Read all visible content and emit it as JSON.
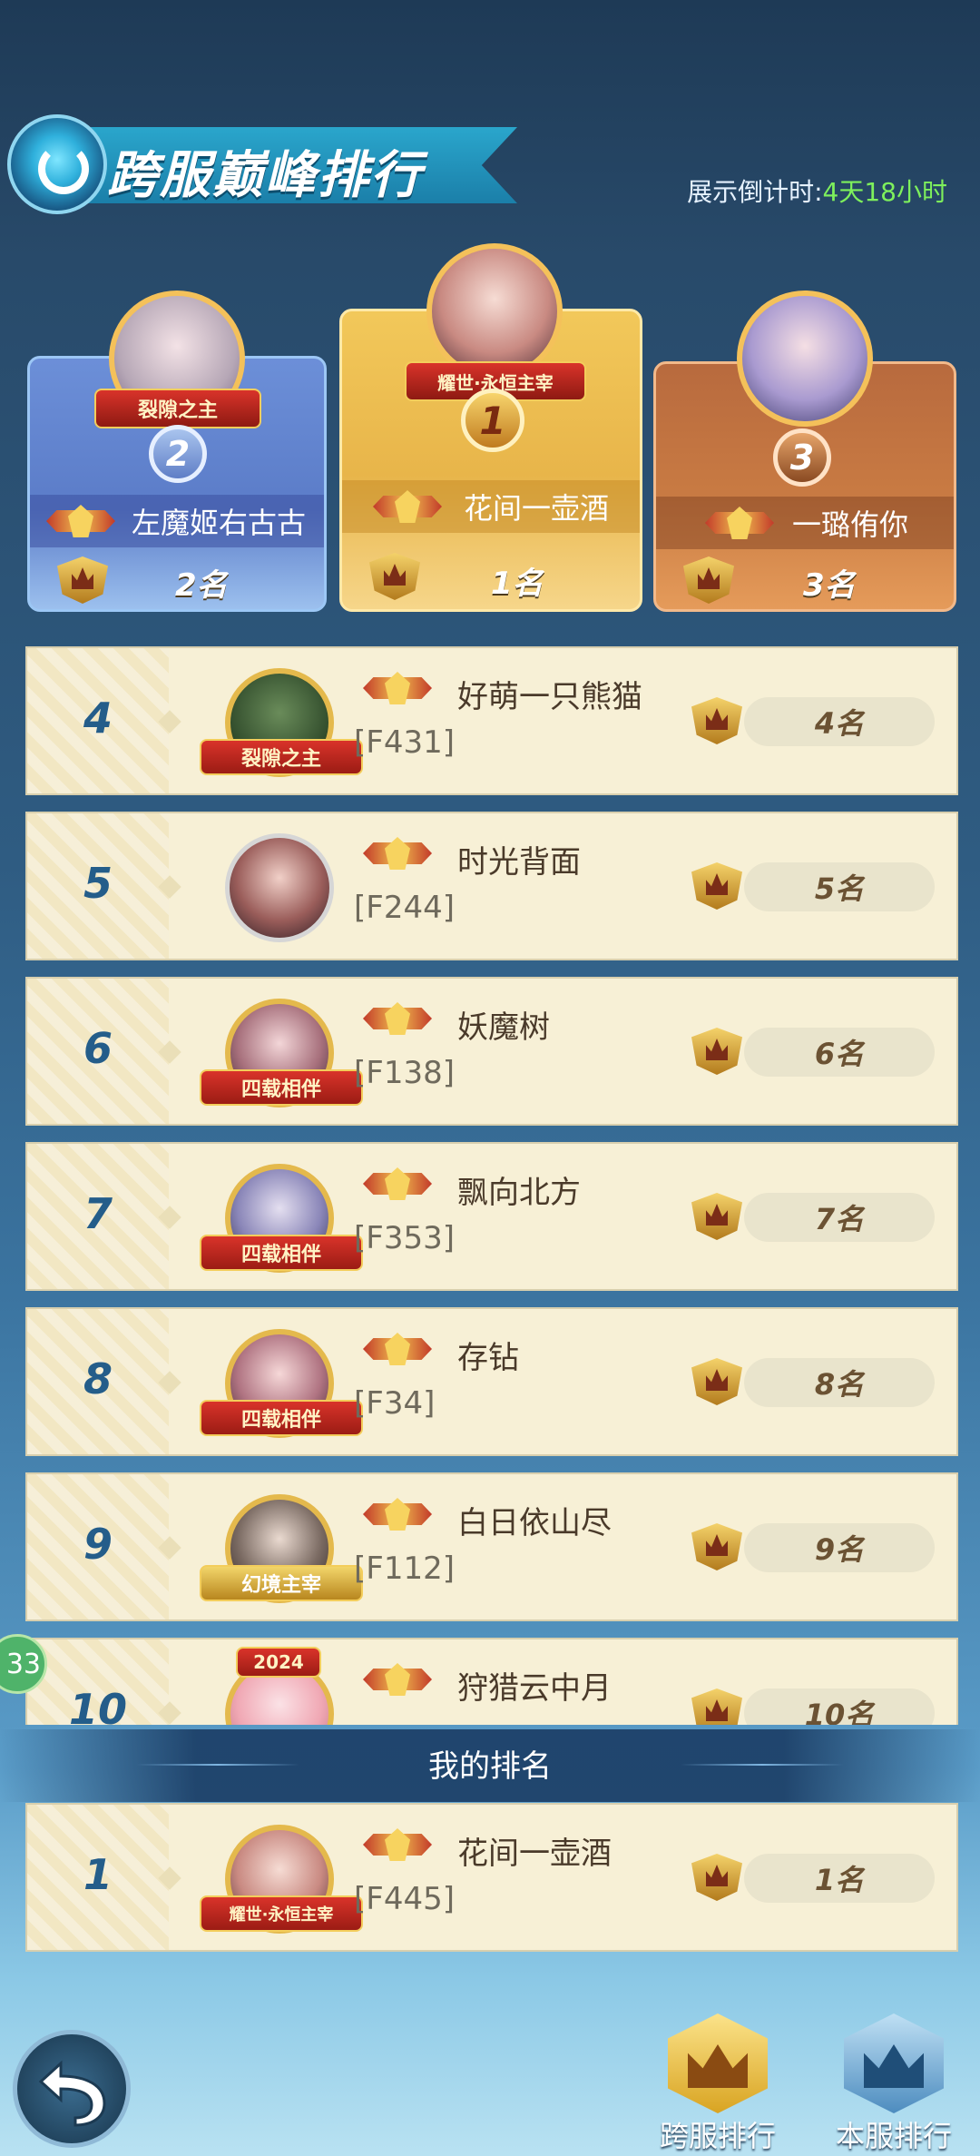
{
  "header": {
    "title": "跨服巅峰排行",
    "countdown_label": "展示倒计时:",
    "countdown_value": "4天18小时"
  },
  "podium": [
    {
      "place": "2",
      "title_frame": "裂隙之主",
      "name": "左魔姬右古古",
      "rank_text": "2名"
    },
    {
      "place": "1",
      "title_frame": "耀世·永恒主宰",
      "name": "花间一壶酒",
      "rank_text": "1名"
    },
    {
      "place": "3",
      "title_frame": "",
      "name": "一璐侑你",
      "rank_text": "3名"
    }
  ],
  "rows": [
    {
      "rank": "4",
      "frame": "裂隙之主",
      "name": "好萌一只熊猫",
      "server": "[F431]",
      "rank_text": "4名"
    },
    {
      "rank": "5",
      "frame": "",
      "name": "时光背面",
      "server": "[F244]",
      "rank_text": "5名"
    },
    {
      "rank": "6",
      "frame": "四载相伴",
      "name": "妖魔树",
      "server": "[F138]",
      "rank_text": "6名"
    },
    {
      "rank": "7",
      "frame": "四载相伴",
      "name": "飘向北方",
      "server": "[F353]",
      "rank_text": "7名"
    },
    {
      "rank": "8",
      "frame": "四载相伴",
      "name": "存钻",
      "server": "[F34]",
      "rank_text": "8名"
    },
    {
      "rank": "9",
      "frame": "幻境主宰",
      "name": "白日依山尽",
      "server": "[F112]",
      "rank_text": "9名"
    },
    {
      "rank": "10",
      "frame": "2024",
      "name": "狩猎云中月",
      "server": "",
      "rank_text": "10名"
    }
  ],
  "my_rank": {
    "title": "我的排名",
    "rank": "1",
    "frame": "耀世·永恒主宰",
    "name": "花间一壶酒",
    "server": "[F445]",
    "rank_text": "1名"
  },
  "side_badge": "33",
  "bottom": {
    "cross_server_label": "跨服排行",
    "local_server_label": "本服排行"
  },
  "colors": {
    "accent_gold": "#f4c15a",
    "countdown_green": "#7ef05c",
    "rank_blue": "#245d8a"
  }
}
